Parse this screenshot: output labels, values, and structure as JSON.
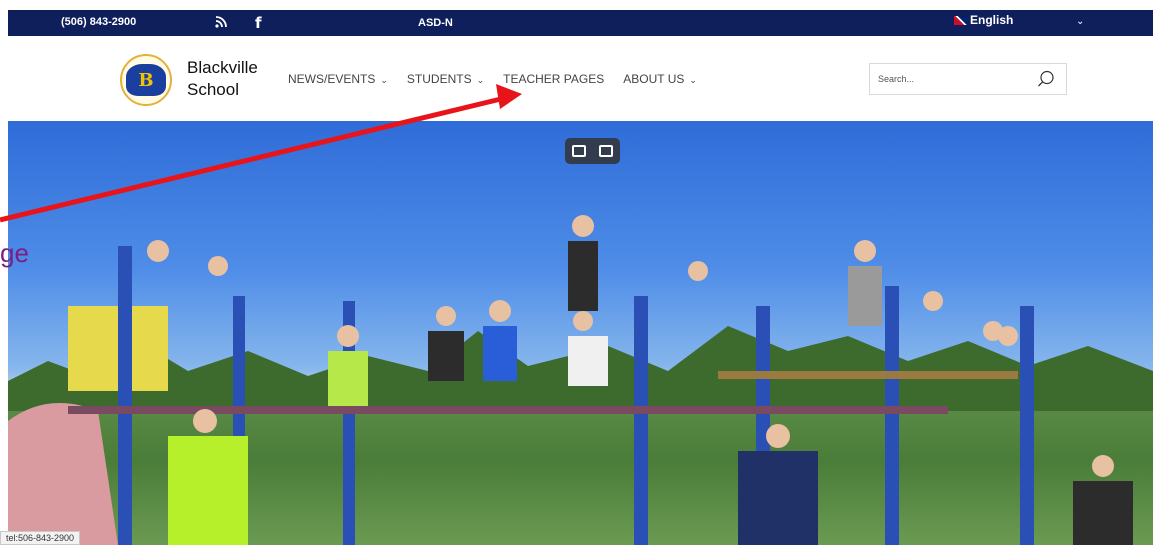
{
  "topbar": {
    "phone": "(506) 843-2900",
    "asd": "ASD-N",
    "language": "English"
  },
  "header": {
    "site_name_line1": "Blackville",
    "site_name_line2": "School",
    "logo_letter": "B"
  },
  "nav": [
    {
      "label": "NEWS/EVENTS",
      "has_dropdown": true
    },
    {
      "label": "STUDENTS",
      "has_dropdown": true
    },
    {
      "label": "TEACHER PAGES",
      "has_dropdown": false
    },
    {
      "label": "ABOUT US",
      "has_dropdown": true
    }
  ],
  "search": {
    "placeholder": "Search..."
  },
  "annotation": {
    "text_fragment": "ge",
    "arrow_color": "#e8141a"
  },
  "status_bar": {
    "url": "tel:506-843-2900"
  },
  "colors": {
    "topbar_bg": "#0f1f5c",
    "nav_text": "#444444",
    "annotation_text": "#7a1f85"
  }
}
